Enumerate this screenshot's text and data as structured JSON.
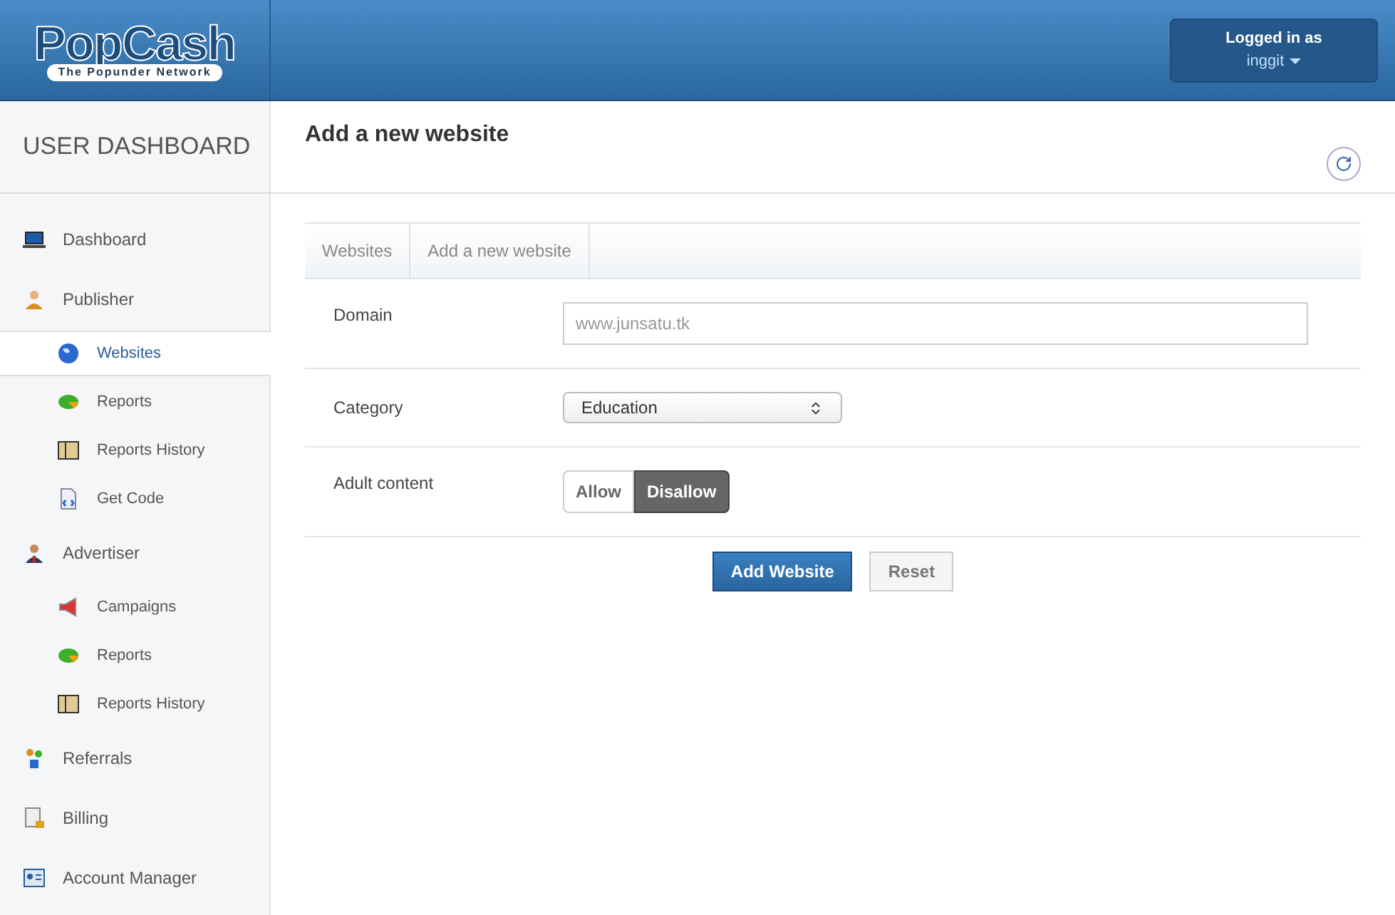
{
  "logo": {
    "name": "PopCash",
    "tagline": "The Popunder Network"
  },
  "user_menu": {
    "label": "Logged in as",
    "username": "inggit"
  },
  "sidebar": {
    "title": "USER DASHBOARD",
    "items": [
      {
        "label": "Dashboard",
        "kind": "laptop",
        "selected": false
      },
      {
        "label": "Publisher",
        "kind": "person",
        "selected": false,
        "children": [
          {
            "label": "Websites",
            "kind": "globe",
            "selected": true
          },
          {
            "label": "Reports",
            "kind": "pie",
            "selected": false
          },
          {
            "label": "Reports History",
            "kind": "folder",
            "selected": false
          },
          {
            "label": "Get Code",
            "kind": "code",
            "selected": false
          }
        ]
      },
      {
        "label": "Advertiser",
        "kind": "suit",
        "selected": false,
        "children": [
          {
            "label": "Campaigns",
            "kind": "megaphone",
            "selected": false
          },
          {
            "label": "Reports",
            "kind": "pie",
            "selected": false
          },
          {
            "label": "Reports History",
            "kind": "folder",
            "selected": false
          }
        ]
      },
      {
        "label": "Referrals",
        "kind": "people",
        "selected": false
      },
      {
        "label": "Billing",
        "kind": "bill",
        "selected": false
      },
      {
        "label": "Account Manager",
        "kind": "card",
        "selected": false
      }
    ]
  },
  "page": {
    "title": "Add a new website"
  },
  "breadcrumb": [
    "Websites",
    "Add a new website"
  ],
  "form": {
    "domain": {
      "label": "Domain",
      "placeholder": "www.junsatu.tk"
    },
    "category": {
      "label": "Category",
      "value": "Education"
    },
    "adult_content": {
      "label": "Adult content",
      "options": [
        {
          "label": "Allow",
          "selected": false
        },
        {
          "label": "Disallow",
          "selected": true
        }
      ]
    },
    "buttons": [
      {
        "label": "Add Website",
        "kind": "primary"
      },
      {
        "label": "Reset",
        "kind": "default"
      }
    ]
  }
}
